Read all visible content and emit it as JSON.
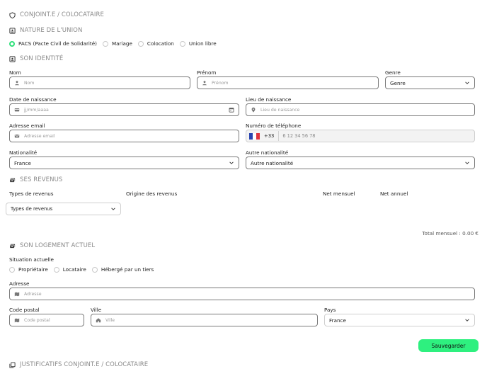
{
  "sections": {
    "spouse": "CONJOINT.E / COLOCATAIRE",
    "union": "NATURE DE L'UNION",
    "identity": "SON IDENTITÉ",
    "income": "SES REVENUS",
    "housing": "SON LOGEMENT ACTUEL",
    "docs": "JUSTIFICATIFS CONJOINT.E / COLOCATAIRE"
  },
  "union_options": [
    {
      "label": "PACS (Pacte Civil de Solidarité)",
      "selected": true
    },
    {
      "label": "Mariage",
      "selected": false
    },
    {
      "label": "Colocation",
      "selected": false
    },
    {
      "label": "Union libre",
      "selected": false
    }
  ],
  "identity": {
    "nom_label": "Nom",
    "nom_placeholder": "Nom",
    "prenom_label": "Prénom",
    "prenom_placeholder": "Prénom",
    "genre_label": "Genre",
    "genre_value": "Genre",
    "dob_label": "Date de naissance",
    "dob_placeholder": "jj/mm/aaaa",
    "pob_label": "Lieu de naissance",
    "pob_placeholder": "Lieu de naissance",
    "email_label": "Adresse email",
    "email_placeholder": "Adresse email",
    "phone_label": "Numéro de téléphone",
    "phone_code": "+33",
    "phone_placeholder": "6 12 34 56 78",
    "nat_label": "Nationalité",
    "nat_value": "France",
    "nat2_label": "Autre nationalité",
    "nat2_value": "Autre nationalité"
  },
  "income": {
    "col_types": "Types de revenus",
    "col_origin": "Origine des revenus",
    "col_net_month": "Net mensuel",
    "col_net_year": "Net annuel",
    "type_select": "Types de revenus",
    "total": "Total mensuel : 0.00 €"
  },
  "housing": {
    "situation_label": "Situation actuelle",
    "options": [
      {
        "label": "Propriétaire",
        "selected": false
      },
      {
        "label": "Locataire",
        "selected": false
      },
      {
        "label": "Hébergé par un tiers",
        "selected": false
      }
    ],
    "address_label": "Adresse",
    "address_placeholder": "Adresse",
    "zip_label": "Code postal",
    "zip_placeholder": "Code postal",
    "city_label": "Ville",
    "city_placeholder": "Ville",
    "country_label": "Pays",
    "country_value": "France"
  },
  "save_label": "Sauvegarder",
  "colors": {
    "accent": "#2ef07f",
    "border": "#7a7a7a",
    "muted": "#8a8a8a"
  }
}
